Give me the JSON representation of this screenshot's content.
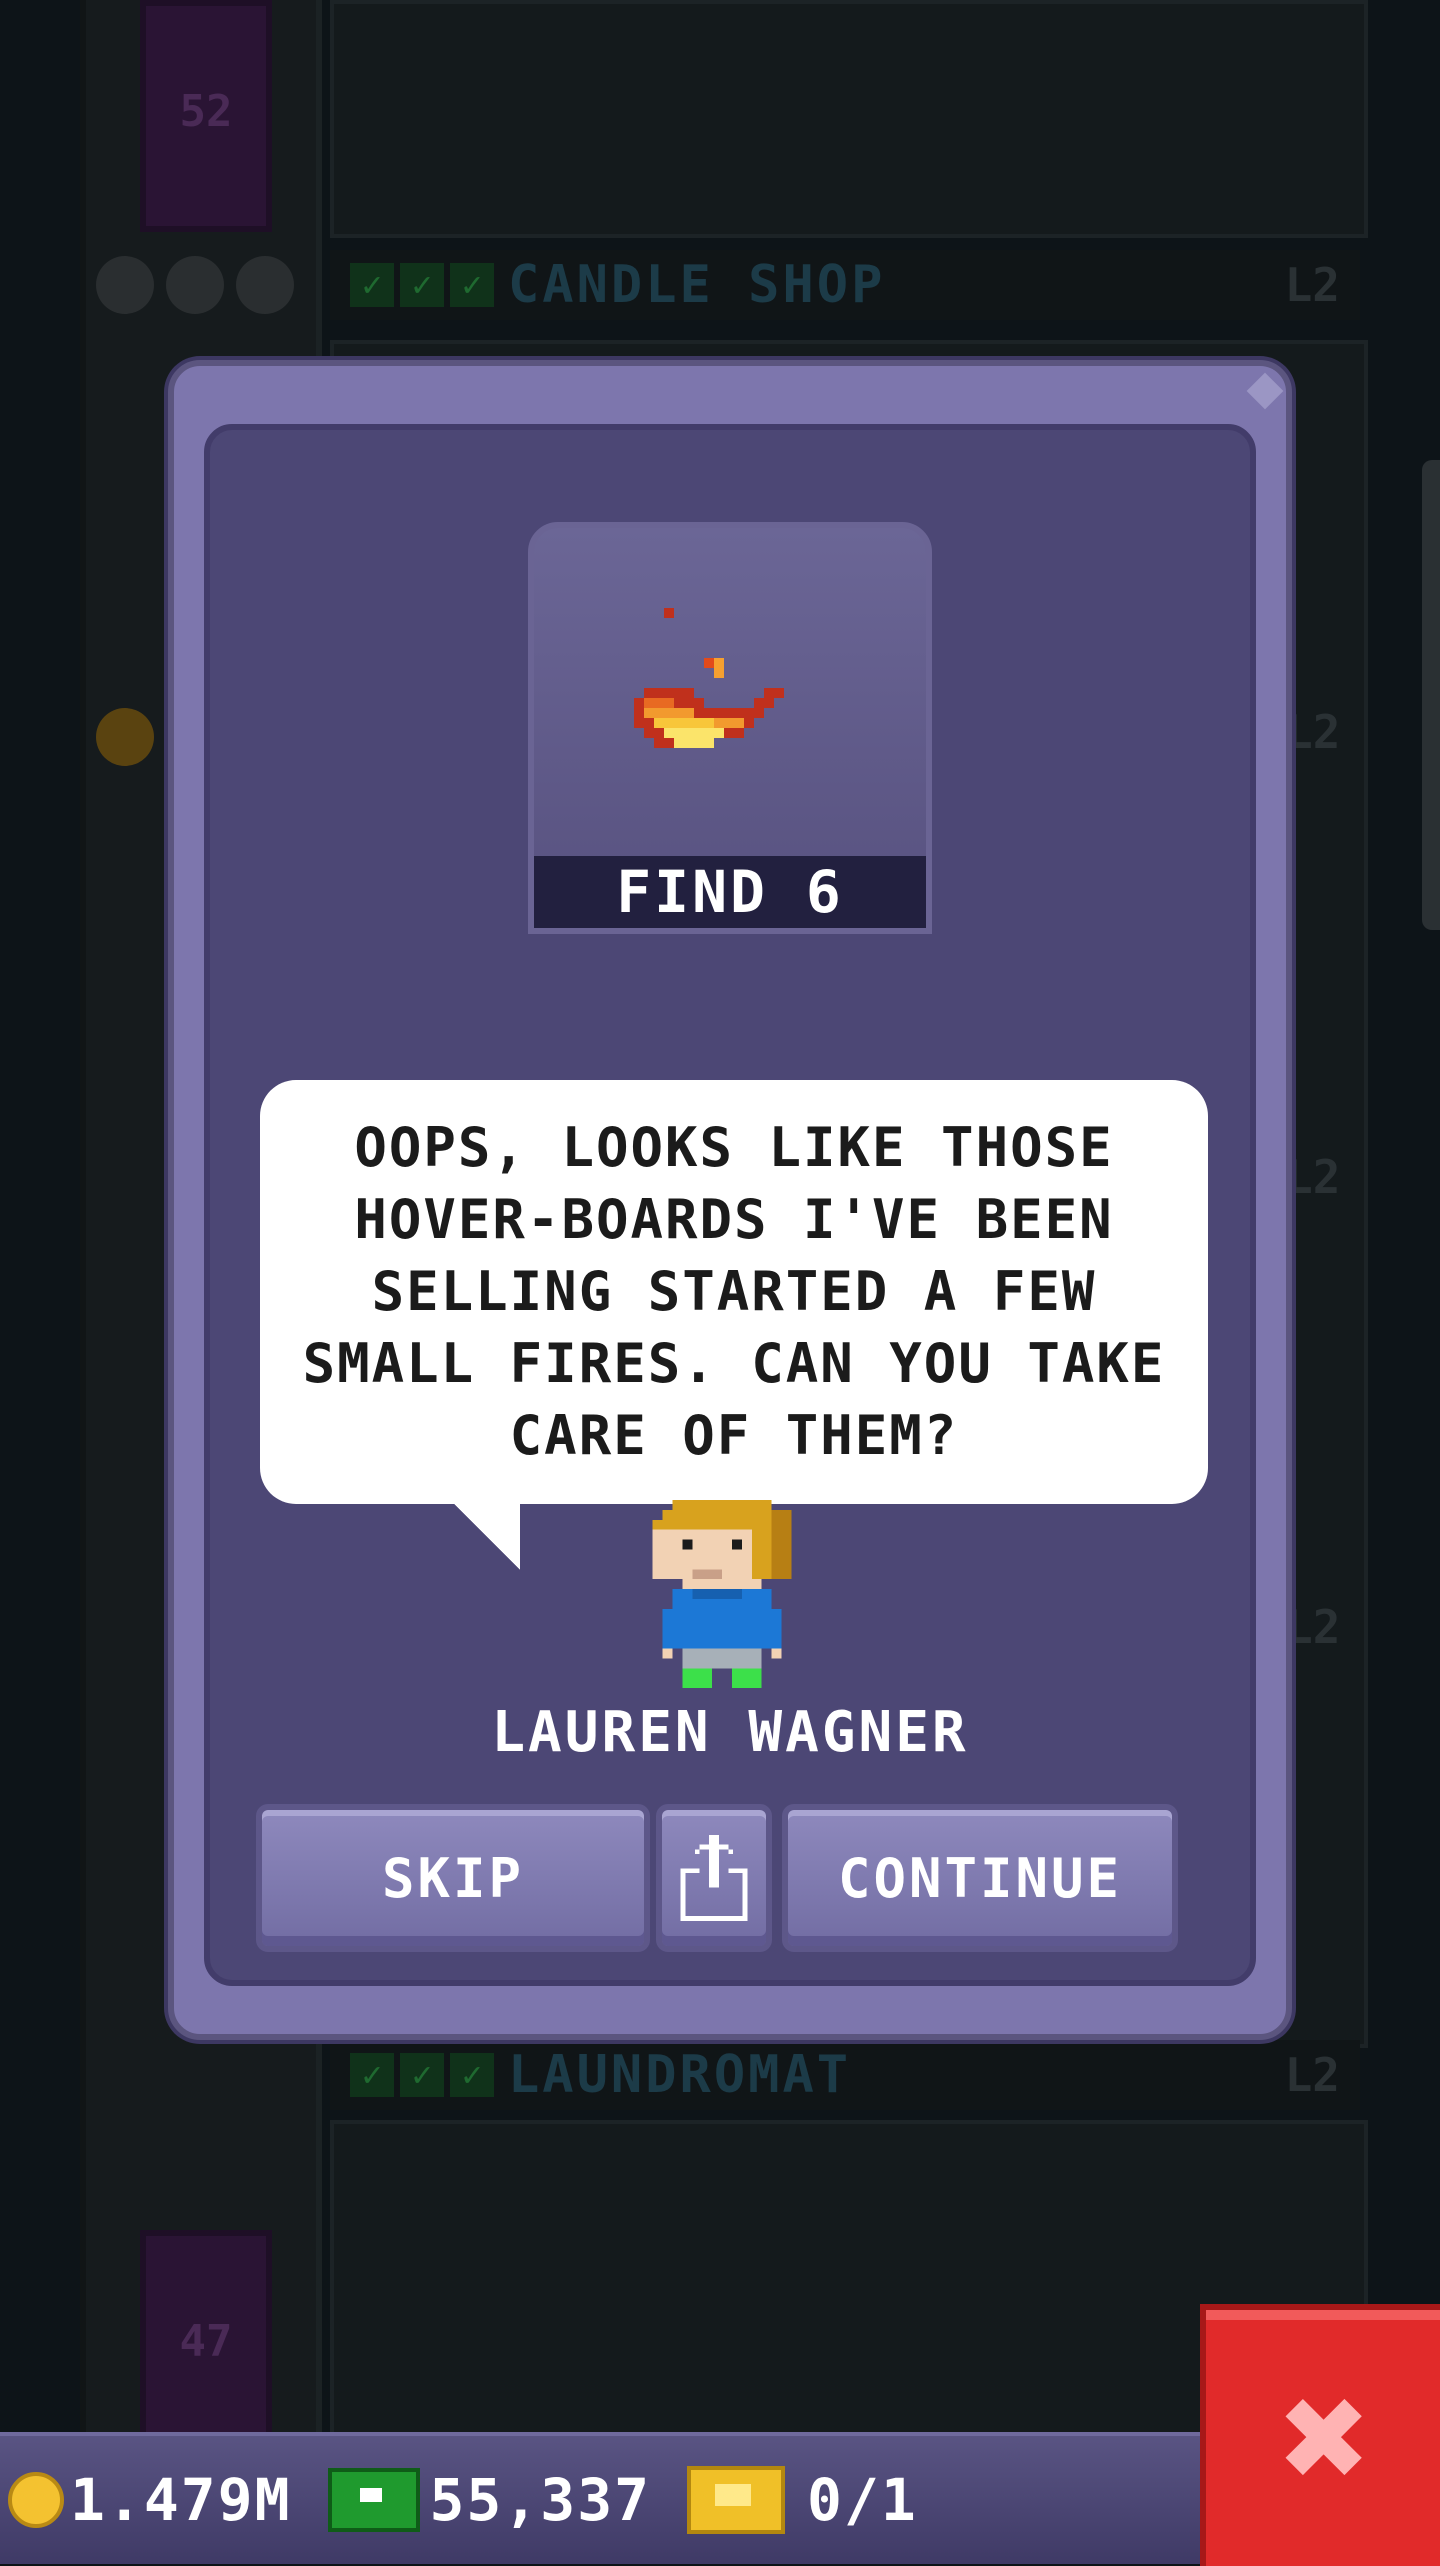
{
  "background": {
    "floors": [
      {
        "name": "CANDLE SHOP",
        "level": "L2"
      },
      {
        "name": "LAUNDROMAT",
        "level": "L2"
      }
    ],
    "elevator_floor_numbers": [
      "52",
      "47"
    ],
    "side_levels": [
      "L2",
      "L2",
      "L2"
    ]
  },
  "mission": {
    "item_label": "FIND 6",
    "item_icon": "fire-icon",
    "message": "OOPS, LOOKS LIKE THOSE HOVER-BOARDS I'VE BEEN SELLING STARTED A FEW SMALL FIRES. CAN YOU TAKE CARE OF THEM?",
    "character_name": "LAUREN WAGNER",
    "buttons": {
      "skip": "SKIP",
      "share_icon": "share-icon",
      "continue": "CONTINUE"
    }
  },
  "status": {
    "coins": "1.479M",
    "bux": "55,337",
    "tickets": "0/1"
  },
  "colors": {
    "modal": "#7d76ad",
    "modal_inner": "#4c4775",
    "button": "#8e89bd",
    "close": "#e12a2a"
  }
}
